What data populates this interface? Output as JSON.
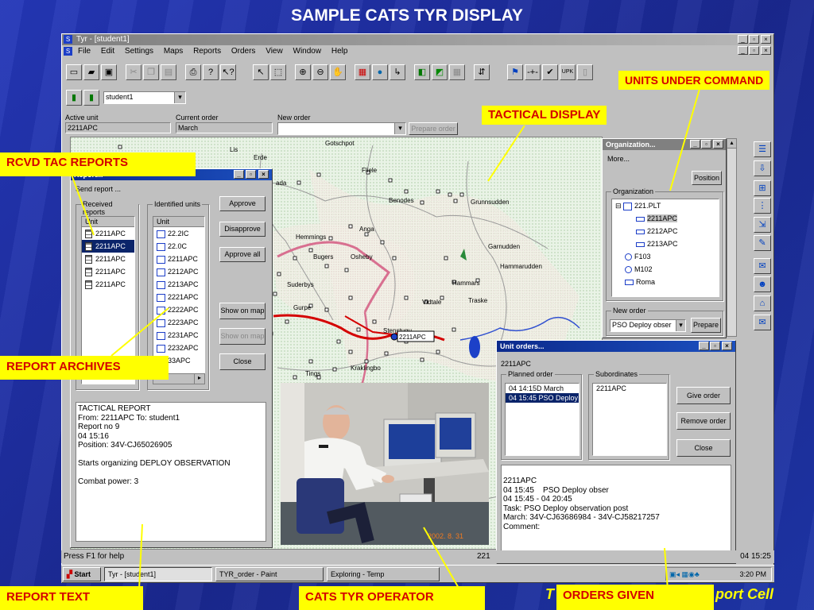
{
  "slide": {
    "title": "SAMPLE CATS TYR DISPLAY",
    "footer_left_partial": "T",
    "footer_right_partial": "port Cell"
  },
  "app": {
    "title": "Tyr - [student1]",
    "menu": [
      "File",
      "Edit",
      "Settings",
      "Maps",
      "Reports",
      "Orders",
      "View",
      "Window",
      "Help"
    ],
    "user_select": "student1",
    "active_unit_label": "Active unit",
    "active_unit": "2211APC",
    "current_order_label": "Current order",
    "current_order": "March",
    "new_order_label": "New order",
    "prepare_order": "Prepare order",
    "status_help": "Press F1 for help",
    "status_time": "04 15:25",
    "status_mid": "221"
  },
  "map": {
    "places": [
      "Gotschpot",
      "Erde",
      "Lis",
      "Fliele",
      "Benodes",
      "Grunnsudden",
      "Anga",
      "Hemmings",
      "Bugers",
      "Osheby",
      "Garnudden",
      "Hammarudden",
      "Suderbys",
      "Hammars",
      "Vidtale",
      "Traske",
      "Gurpe",
      "Stenstugu",
      "Tings",
      "Kraklingbo",
      "ada"
    ],
    "unit_label": "2211APC"
  },
  "send_report": {
    "title": "Report...",
    "subtitle": "Send report ...",
    "received_caption": "Received reports",
    "identified_caption": "Identified units",
    "unit_header": "Unit",
    "received": [
      "2211APC",
      "2211APC",
      "2211APC",
      "2211APC",
      "2211APC"
    ],
    "identified": [
      "22.2IC",
      "22.0C",
      "2211APC",
      "2212APC",
      "2213APC",
      "2221APC",
      "2222APC",
      "2223APC",
      "2231APC",
      "2232APC",
      "33APC"
    ],
    "approve": "Approve",
    "disapprove": "Disapprove",
    "approve_all": "Approve all",
    "show_on_map": "Show on map",
    "show_on_map_2": "Show on map",
    "close": "Close",
    "report_text": "TACTICAL REPORT\nFrom: 2211APC To: student1\nReport no 9\n04 15:16\nPosition: 34V-CJ65026905\n\nStarts organizing DEPLOY OBSERVATION\n\nCombat power: 3"
  },
  "organization": {
    "title": "Organization...",
    "more": "More...",
    "position": "Position",
    "org_caption": "Organization",
    "tree": [
      "221.PLT",
      "2211APC",
      "2212APC",
      "2213APC",
      "F103",
      "M102",
      "Roma"
    ],
    "new_order_caption": "New order",
    "new_order_value": "PSO Deploy obser",
    "prepare": "Prepare"
  },
  "unit_orders": {
    "title": "Unit orders...",
    "unit": "2211APC",
    "planned_caption": "Planned order",
    "subordinates_caption": "Subordinates",
    "planned": [
      "04 14:15D March",
      "04 15:45 PSO Deploy"
    ],
    "subordinates": [
      "2211APC"
    ],
    "give_order": "Give order",
    "remove_order": "Remove order",
    "close": "Close",
    "detail": "2211APC\n04 15:45    PSO Deploy obser\n04 15:45 - 04 20:45\nTask: PSO Deploy observation post\nMarch: 34V-CJ63686984 - 34V-CJ58217257\nComment:"
  },
  "photo": {
    "date_stamp": "2002. 8. 31"
  },
  "taskbar": {
    "start": "Start",
    "tasks": [
      "Tyr - [student1]",
      "TYR_order - Paint",
      "Exploring - Temp"
    ],
    "clock": "3:20 PM"
  },
  "callouts": {
    "units_under_command": "UNITS UNDER COMMAND",
    "tactical_display": "TACTICAL DISPLAY",
    "rcvd_tac_reports": "RCVD TAC REPORTS",
    "report_archives": "REPORT ARCHIVES",
    "report_text": "REPORT TEXT",
    "cats_tyr_operator": "CATS TYR OPERATOR",
    "orders_given": "ORDERS GIVEN"
  },
  "colors": {
    "callout_bg": "#ffff00",
    "callout_text": "#d40000",
    "slide_bg": "#1e30a8",
    "selection": "#0a246a"
  }
}
